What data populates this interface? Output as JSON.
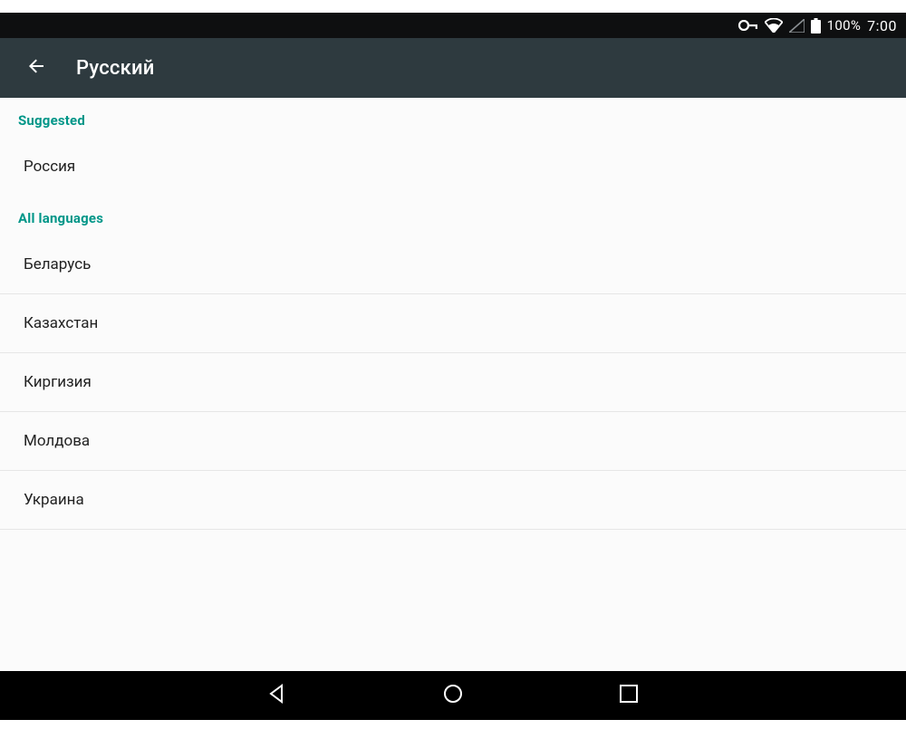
{
  "statusBar": {
    "batteryPct": "100%",
    "clock": "7:00"
  },
  "appBar": {
    "title": "Русский"
  },
  "sections": {
    "suggested": {
      "header": "Suggested",
      "items": [
        "Россия"
      ]
    },
    "all": {
      "header": "All languages",
      "items": [
        "Беларусь",
        "Казахстан",
        "Киргизия",
        "Молдова",
        "Украина"
      ]
    }
  }
}
